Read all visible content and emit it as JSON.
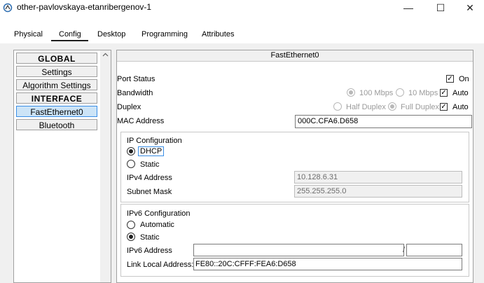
{
  "window": {
    "title": "other-pavlovskaya-etanribergenov-1",
    "app_icon": "packet-tracer-icon",
    "controls": {
      "minimize": "—",
      "maximize": "☐",
      "close": "✕"
    }
  },
  "tabs": [
    "Physical",
    "Config",
    "Desktop",
    "Programming",
    "Attributes"
  ],
  "active_tab": "Config",
  "sidebar": {
    "items": [
      {
        "label": "GLOBAL",
        "type": "header"
      },
      {
        "label": "Settings",
        "type": "item"
      },
      {
        "label": "Algorithm Settings",
        "type": "item"
      },
      {
        "label": "INTERFACE",
        "type": "header"
      },
      {
        "label": "FastEthernet0",
        "type": "item",
        "selected": true
      },
      {
        "label": "Bluetooth",
        "type": "item"
      }
    ]
  },
  "panel": {
    "title": "FastEthernet0",
    "port_status": {
      "label": "Port Status",
      "on_label": "On",
      "on_checked": true
    },
    "bandwidth": {
      "label": "Bandwidth",
      "opt100": "100 Mbps",
      "opt10": "10 Mbps",
      "auto_label": "Auto",
      "auto_checked": true
    },
    "duplex": {
      "label": "Duplex",
      "half": "Half Duplex",
      "full": "Full Duplex",
      "auto_label": "Auto",
      "auto_checked": true
    },
    "mac": {
      "label": "MAC Address",
      "value": "000C.CFA6.D658"
    },
    "ip_config": {
      "title": "IP Configuration",
      "dhcp": "DHCP",
      "static": "Static",
      "selected": "DHCP",
      "ipv4_label": "IPv4 Address",
      "ipv4_value": "10.128.6.31",
      "mask_label": "Subnet Mask",
      "mask_value": "255.255.255.0"
    },
    "ipv6_config": {
      "title": "IPv6 Configuration",
      "automatic": "Automatic",
      "static": "Static",
      "selected": "Static",
      "ipv6_label": "IPv6 Address",
      "ipv6_value": "",
      "prefix_sep": "/",
      "prefix_value": "",
      "link_local_label": "Link Local Address:",
      "link_local_value": "FE80::20C:CFFF:FEA6:D658"
    }
  }
}
